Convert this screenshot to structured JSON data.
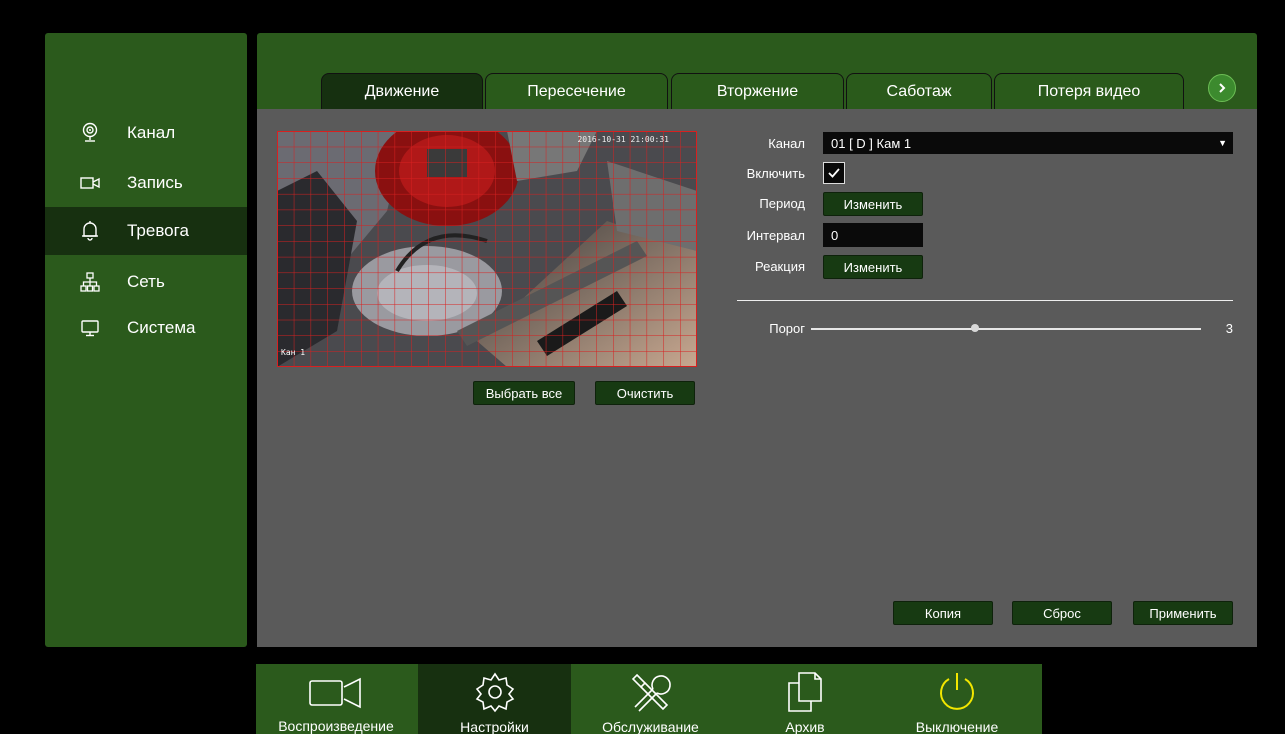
{
  "sidebar": {
    "items": [
      {
        "label": "Канал",
        "icon": "camera-icon"
      },
      {
        "label": "Запись",
        "icon": "video-record-icon"
      },
      {
        "label": "Тревога",
        "icon": "bell-icon"
      },
      {
        "label": "Сеть",
        "icon": "network-icon"
      },
      {
        "label": "Система",
        "icon": "monitor-icon"
      }
    ],
    "active": "Тревога"
  },
  "tabs": {
    "items": [
      "Движение",
      "Пересечение",
      "Вторжение",
      "Саботаж",
      "Потеря видео"
    ],
    "active": "Движение",
    "next_icon": "chevron-right-icon"
  },
  "video": {
    "timestamp": "2016-10-31 21:00:31",
    "camera_name": "Кан 1",
    "select_all_label": "Выбрать все",
    "clear_label": "Очистить"
  },
  "form": {
    "channel_label": "Канал",
    "channel_value": "01 [ D ] Кам 1",
    "enable_label": "Включить",
    "enable_checked": true,
    "period_label": "Период",
    "period_button": "Изменить",
    "interval_label": "Интервал",
    "interval_value": "0",
    "reaction_label": "Реакция",
    "reaction_button": "Изменить",
    "threshold_label": "Порог",
    "threshold_value": "3"
  },
  "actions": {
    "copy_label": "Копия",
    "reset_label": "Сброс",
    "apply_label": "Применить"
  },
  "dock": {
    "items": [
      {
        "label": "Воспроизведение",
        "icon": "video-camera-icon"
      },
      {
        "label": "Настройки",
        "icon": "settings-gear-icon"
      },
      {
        "label": "Обслуживание",
        "icon": "tools-icon"
      },
      {
        "label": "Архив",
        "icon": "documents-icon"
      },
      {
        "label": "Выключение",
        "icon": "power-icon"
      }
    ],
    "active": "Настройки"
  },
  "colors": {
    "panel_green": "#2b5a1c",
    "active_green": "#173010",
    "content_gray": "#5a5a5a",
    "grid_red": "#d22020",
    "accent_green": "#3c8a2e"
  }
}
